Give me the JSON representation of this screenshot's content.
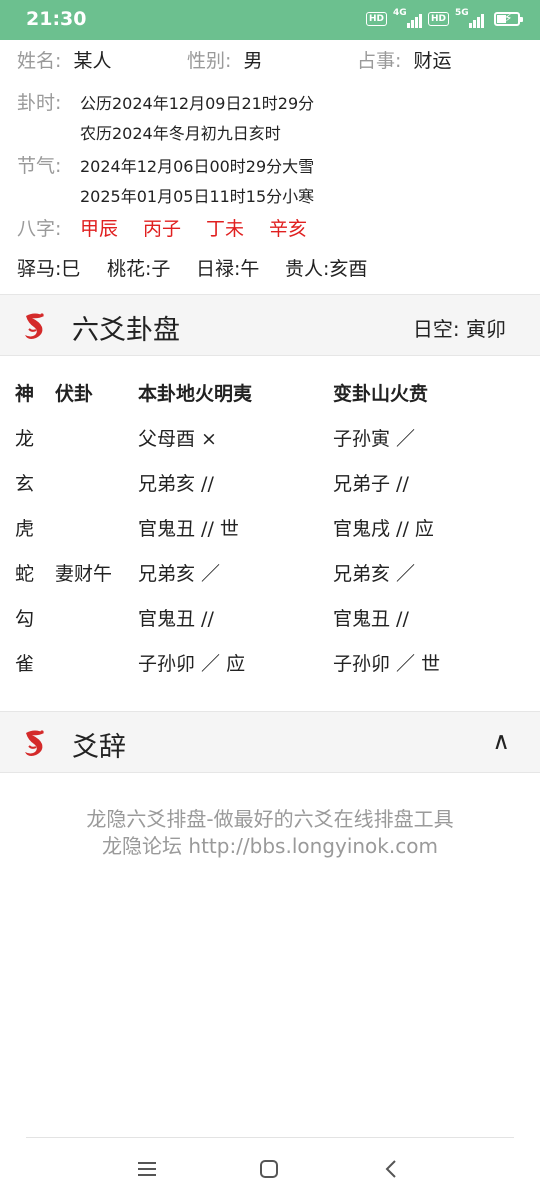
{
  "status_bar": {
    "time": "21:30",
    "hd1": "HD",
    "net1": "4G",
    "hd2": "HD",
    "net2": "5G"
  },
  "info": {
    "name_label": "姓名:",
    "name_value": "某人",
    "gender_label": "性别:",
    "gender_value": "男",
    "matter_label": "占事:",
    "matter_value": "财运",
    "time_label": "卦时:",
    "time_solar": "公历2024年12月09日21时29分",
    "time_lunar": "农历2024年冬月初九日亥时",
    "solar_term_label": "节气:",
    "solar_term_1": "2024年12月06日00时29分大雪",
    "solar_term_2": "2025年01月05日11时15分小寒",
    "bazi_label": "八字:",
    "bazi": [
      "甲辰",
      "丙子",
      "丁未",
      "辛亥"
    ],
    "shensha": [
      "驿马:巳",
      "桃花:子",
      "日禄:午",
      "贵人:亥酉"
    ]
  },
  "gua_section": {
    "title": "六爻卦盘",
    "rikong": "日空: 寅卯"
  },
  "table": {
    "headers": [
      "神",
      "伏卦",
      "本卦地火明夷",
      "变卦山火贲"
    ],
    "rows": [
      {
        "shen": "龙",
        "fu": "",
        "ben": "父母酉 ×",
        "bian": "子孙寅 ／"
      },
      {
        "shen": "玄",
        "fu": "",
        "ben": "兄弟亥 //",
        "bian": "兄弟子 //"
      },
      {
        "shen": "虎",
        "fu": "",
        "ben": "官鬼丑 // 世",
        "bian": "官鬼戌 // 应"
      },
      {
        "shen": "蛇",
        "fu": "妻财午",
        "ben": "兄弟亥 ／",
        "bian": "兄弟亥 ／"
      },
      {
        "shen": "勾",
        "fu": "",
        "ben": "官鬼丑 //",
        "bian": "官鬼丑 //"
      },
      {
        "shen": "雀",
        "fu": "",
        "ben": "子孙卯 ／ 应",
        "bian": "子孙卯 ／ 世"
      }
    ]
  },
  "yaoci_section": {
    "title": "爻辞",
    "collapse_symbol": "∧"
  },
  "footer": {
    "line1": "龙隐六爻排盘-做最好的六爻在线排盘工具",
    "line2": "龙隐论坛 http://bbs.longyinok.com"
  },
  "colors": {
    "status_bar": "#6cc08f",
    "accent_red": "#e02020",
    "label_gray": "#9a9a9a",
    "section_bg": "#f5f5f5"
  },
  "icons": [
    "dragon-logo-icon",
    "menu-icon",
    "home-icon",
    "back-icon",
    "battery-icon",
    "signal-icon"
  ]
}
